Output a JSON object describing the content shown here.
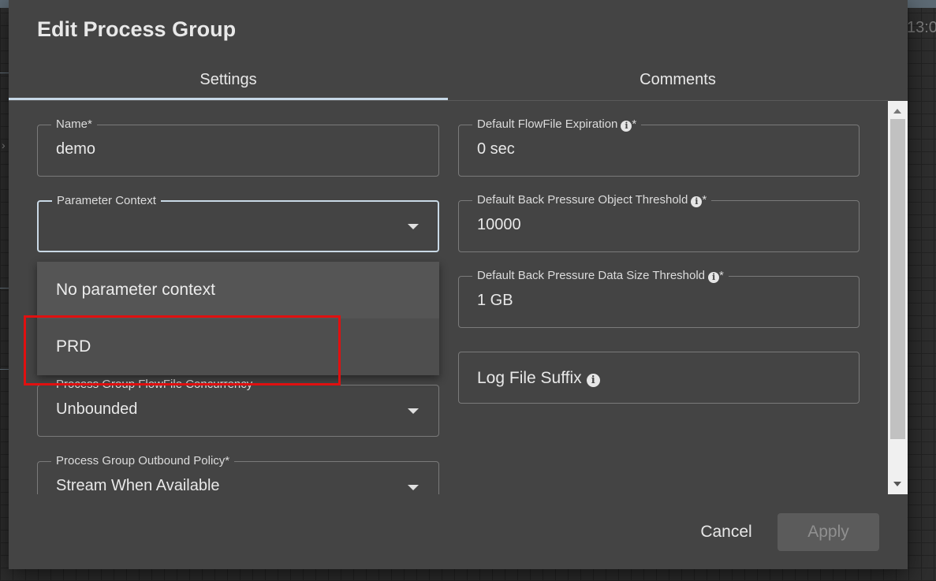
{
  "background": {
    "clock_fragment": "13:0"
  },
  "dialog": {
    "title": "Edit Process Group",
    "tabs": [
      {
        "label": "Settings",
        "active": true
      },
      {
        "label": "Comments",
        "active": false
      }
    ],
    "left_fields": {
      "name": {
        "label": "Name*",
        "value": "demo"
      },
      "parameter_context": {
        "label": "Parameter Context",
        "value": ""
      },
      "concurrency": {
        "label": "Process Group FlowFile Concurrency",
        "value": "Unbounded"
      },
      "outbound_policy": {
        "label": "Process Group Outbound Policy*",
        "value": "Stream When Available"
      }
    },
    "right_fields": {
      "expiration": {
        "label": "Default FlowFile Expiration",
        "required_mark": "*",
        "value": "0 sec"
      },
      "object_threshold": {
        "label": "Default Back Pressure Object Threshold",
        "required_mark": "*",
        "value": "10000"
      },
      "data_size_threshold": {
        "label": "Default Back Pressure Data Size Threshold",
        "required_mark": "*",
        "value": "1 GB"
      },
      "log_file_suffix": {
        "label": "Log File Suffix",
        "value": ""
      }
    },
    "dropdown_options": [
      "No parameter context",
      "PRD"
    ],
    "highlighted_option": "PRD",
    "buttons": {
      "cancel": "Cancel",
      "apply": "Apply"
    }
  },
  "icons": {
    "info": "info-icon",
    "dropdown_arrow": "caret-down-icon"
  },
  "colors": {
    "dialog_bg": "#444444",
    "tab_indicator": "#c6d8e6",
    "highlight_box": "#e01010"
  }
}
